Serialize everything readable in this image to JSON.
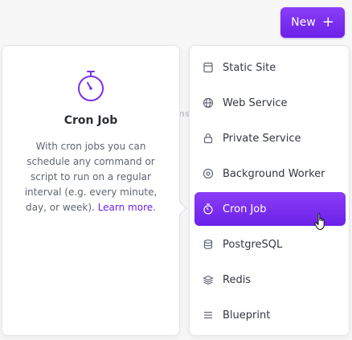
{
  "toolbar": {
    "new_label": "New",
    "new_icon": "plus-icon"
  },
  "info_card": {
    "icon": "stopwatch-icon",
    "title": "Cron Job",
    "description": "With cron jobs you can schedule any command or script to run on a regular interval (e.g. every minute, day, or week).",
    "learn_more": "Learn more"
  },
  "background": {
    "fragment": "ns"
  },
  "menu": {
    "items": [
      {
        "label": "Static Site",
        "icon": "file-icon"
      },
      {
        "label": "Web Service",
        "icon": "globe-icon"
      },
      {
        "label": "Private Service",
        "icon": "lock-icon"
      },
      {
        "label": "Background Worker",
        "icon": "gear-icon"
      },
      {
        "label": "Cron Job",
        "icon": "stopwatch-icon",
        "active": true
      },
      {
        "label": "PostgreSQL",
        "icon": "database-icon"
      },
      {
        "label": "Redis",
        "icon": "stack-icon"
      },
      {
        "label": "Blueprint",
        "icon": "lines-icon"
      }
    ]
  },
  "colors": {
    "accent": "#6b21e8",
    "accent_light": "#8a3ef7"
  }
}
